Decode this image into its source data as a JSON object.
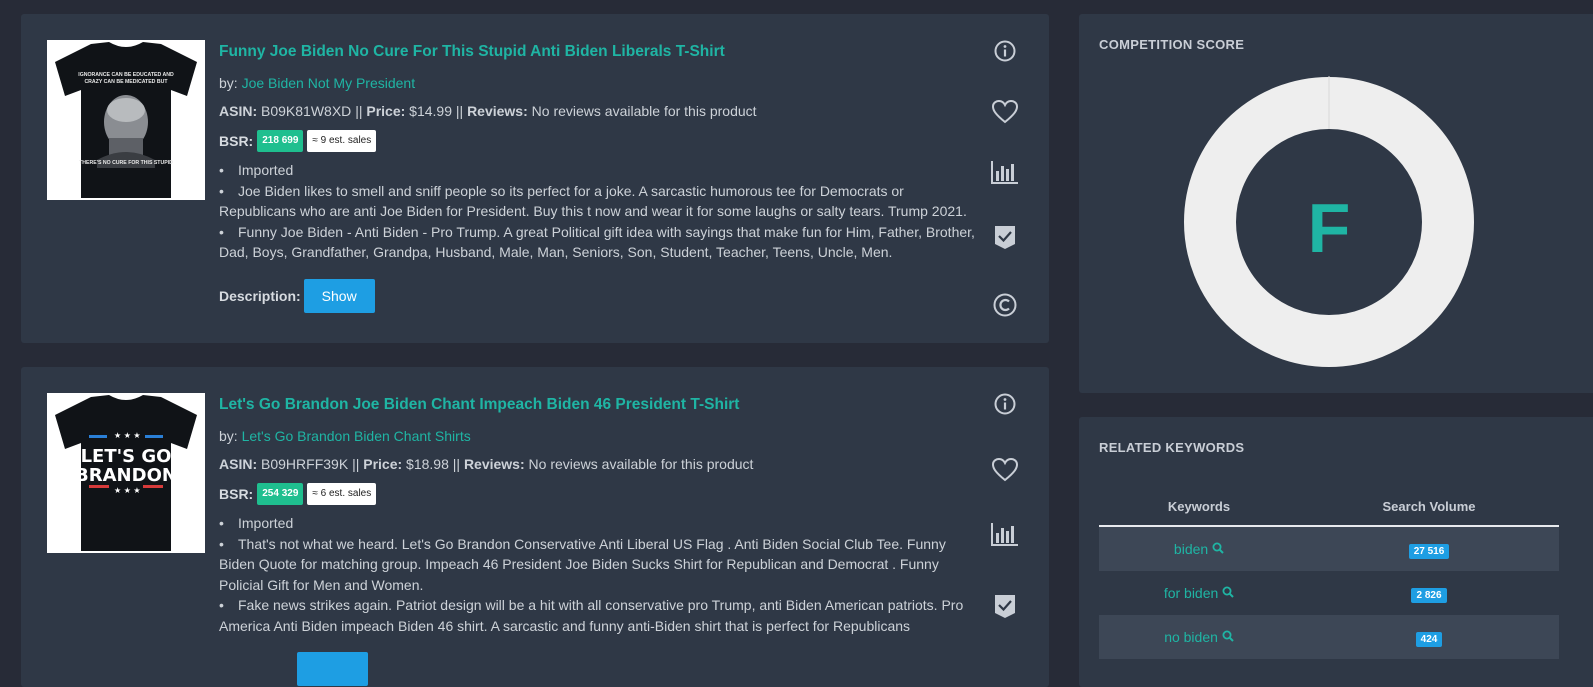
{
  "products": [
    {
      "title": "Funny Joe Biden No Cure For This Stupid Anti Biden Liberals T-Shirt",
      "by_label": "by:",
      "brand": "Joe Biden Not My President",
      "asin_label": "ASIN:",
      "asin": "B09K81W8XD",
      "price_label": "Price:",
      "price": "$14.99",
      "reviews_label": "Reviews:",
      "reviews": "No reviews available for this product",
      "sep": "||",
      "bsr_label": "BSR:",
      "bsr": "218 699",
      "est_sales": "≈ 9 est. sales",
      "bullets": [
        "Imported",
        "Joe Biden likes to smell and sniff people so its perfect for a joke. A sarcastic humorous tee for Democrats or Republicans who are anti Joe Biden for President. Buy this t now and wear it for some laughs or salty tears. Trump 2021.",
        "Funny Joe Biden - Anti Biden - Pro Trump. A great Political gift idea with sayings that make fun for Him, Father, Brother, Dad, Boys, Grandfather, Grandpa, Husband, Male, Man, Seniors, Son, Student, Teacher, Teens, Uncle, Men."
      ],
      "desc_label": "Description:",
      "show_label": "Show",
      "image_text": {
        "top1": "IGNORANCE CAN BE EDUCATED AND",
        "top2": "CRAZY CAN BE MEDICATED BUT",
        "bottom": "THERE'S NO CURE FOR THIS STUPID"
      }
    },
    {
      "title": "Let's Go Brandon Joe Biden Chant Impeach Biden 46 President T-Shirt",
      "by_label": "by:",
      "brand": "Let's Go Brandon Biden Chant Shirts",
      "asin_label": "ASIN:",
      "asin": "B09HRFF39K",
      "price_label": "Price:",
      "price": "$18.98",
      "reviews_label": "Reviews:",
      "reviews": "No reviews available for this product",
      "sep": "||",
      "bsr_label": "BSR:",
      "bsr": "254 329",
      "est_sales": "≈ 6 est. sales",
      "bullets": [
        "Imported",
        "That's not what we heard. Let's Go Brandon Conservative Anti Liberal US Flag . Anti Biden Social Club Tee. Funny Biden Quote for matching group. Impeach 46 President Joe Biden Sucks Shirt for Republican and Democrat . Funny Policial Gift for Men and Women.",
        "Fake news strikes again. Patriot design will be a hit with all conservative pro Trump, anti Biden American patriots. Pro America Anti Biden impeach Biden 46 shirt. A sarcastic and funny anti-Biden shirt that is perfect for Republicans"
      ],
      "image_text": {
        "line1": "LET'S GO",
        "line2": "BRANDON"
      }
    }
  ],
  "icons": [
    "info-icon",
    "heart-icon",
    "bar-chart-icon",
    "shield-check-icon",
    "copyright-icon"
  ],
  "competition": {
    "title": "COMPETITION SCORE",
    "grade": "F",
    "ring_color": "#eeeeee",
    "grade_color": "#1fb5a4"
  },
  "keywords": {
    "title": "RELATED KEYWORDS",
    "col_keywords": "Keywords",
    "col_volume": "Search Volume",
    "rows": [
      {
        "keyword": "biden",
        "volume": "27 516"
      },
      {
        "keyword": "for biden",
        "volume": "2 826"
      },
      {
        "keyword": "no biden",
        "volume": "424"
      }
    ]
  },
  "colors": {
    "accent": "#1fb5a4",
    "button": "#1e9ee3",
    "bsr_badge": "#1fbf8f",
    "card_bg": "#2f3846",
    "page_bg": "#272b37"
  }
}
